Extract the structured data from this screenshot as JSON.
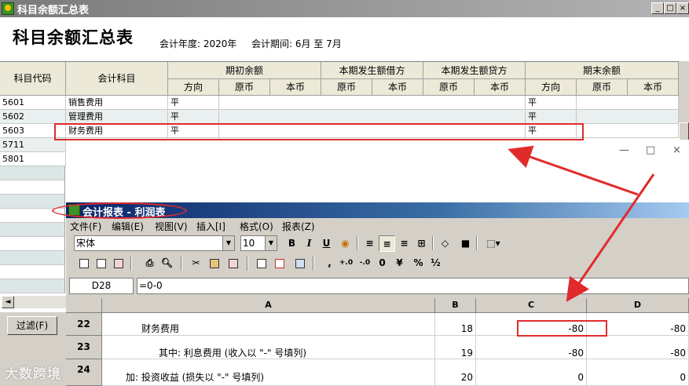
{
  "window1": {
    "title": "科目余额汇总表",
    "controls": {
      "minimize": "_",
      "maximize": "□",
      "close": "×"
    },
    "report_title": "科目余额汇总表",
    "year_label": "会计年度: 2020年",
    "period_label": "会计期间: 6月  至  7月",
    "table": {
      "code_header": "科目代码",
      "subject_header": "会计科目",
      "groups": [
        "期初余额",
        "本期发生额借方",
        "本期发生额贷方",
        "期末余额"
      ],
      "subheaders": [
        "方向",
        "原币",
        "本币",
        "原币",
        "本币",
        "原币",
        "本币",
        "方向",
        "原币",
        "本币"
      ],
      "rows": [
        {
          "code": "5601",
          "name": "销售费用",
          "open_dir": "平",
          "close_dir": "平"
        },
        {
          "code": "5602",
          "name": "管理费用",
          "open_dir": "平",
          "close_dir": "平"
        },
        {
          "code": "5603",
          "name": "财务费用",
          "open_dir": "平",
          "close_dir": "平"
        },
        {
          "code": "5711",
          "name": "",
          "open_dir": "",
          "close_dir": ""
        },
        {
          "code": "5801",
          "name": "",
          "open_dir": "",
          "close_dir": ""
        }
      ]
    },
    "filter_button": "过滤(F)",
    "scroll_left": "◄"
  },
  "window2": {
    "controls": {
      "minimize": "—",
      "maximize": "□",
      "close": "×"
    },
    "title": "会计报表 - 利润表",
    "menu": [
      "文件(F)",
      "编辑(E)",
      "视图(V)",
      "插入[I]",
      "格式(O)",
      "报表(Z)"
    ],
    "font_name": "宋体",
    "font_size": "10",
    "format_buttons": {
      "bold": "B",
      "italic": "I",
      "underline": "U",
      "comma": ",",
      "zero": "0",
      "percent": "%",
      "half": "½"
    },
    "cell_ref": "D28",
    "formula": "=0-0",
    "columns": [
      "A",
      "B",
      "C",
      "D"
    ],
    "rows": [
      {
        "num": "22",
        "a": "财务费用",
        "b": "18",
        "c": "-80",
        "d": "-80"
      },
      {
        "num": "23",
        "a": "其中: 利息费用 (收入以 \"-\" 号填列)",
        "b": "19",
        "c": "-80",
        "d": "-80"
      },
      {
        "num": "24",
        "a": "加: 投资收益 (损失以 \"-\" 号填列)",
        "b": "20",
        "c": "0",
        "d": "0"
      }
    ]
  },
  "watermark": "大数跨境",
  "colors": {
    "annotation": "#e12b2b",
    "title_active": "#0a246a",
    "title_inactive": "#7a7a7a",
    "row_alt": "#e9f0ef"
  }
}
